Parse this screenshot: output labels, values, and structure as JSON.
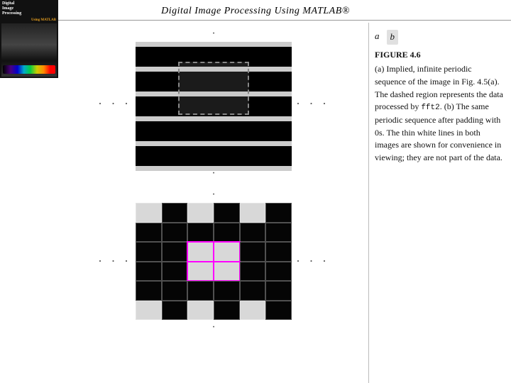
{
  "header": {
    "title": "Digital Image Processing Using MATLAB®"
  },
  "book": {
    "title": "Digital\nImage\nProcessing",
    "matlab_label": "Using MATLAB"
  },
  "figure": {
    "id": "FIGURE 4.6",
    "label_a": "a",
    "label_b": "b",
    "caption": "(a) Implied, infinite periodic sequence of the image in Fig. 4.5(a). The dashed region represents the data processed by fft2. (b) The same periodic sequence after padding with 0s. The thin white lines in both images are shown for convenience in viewing; they are not part of the data.",
    "fft2_code": "fft2"
  },
  "dots": {
    "horizontal": "· · ·",
    "vertical": "·\n·\n·"
  }
}
